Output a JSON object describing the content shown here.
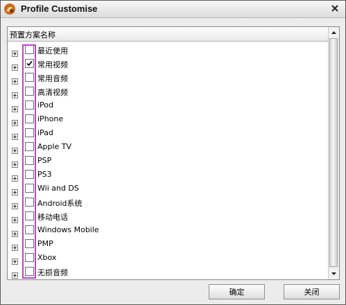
{
  "window": {
    "title": "Profile Customise"
  },
  "table": {
    "header": "预置方案名称"
  },
  "items": [
    {
      "label": "最近使用",
      "checked": false
    },
    {
      "label": "常用视频",
      "checked": true
    },
    {
      "label": "常用音频",
      "checked": false
    },
    {
      "label": "高清视频",
      "checked": false
    },
    {
      "label": "iPod",
      "checked": false
    },
    {
      "label": "iPhone",
      "checked": false
    },
    {
      "label": "iPad",
      "checked": false
    },
    {
      "label": "Apple TV",
      "checked": false
    },
    {
      "label": "PSP",
      "checked": false
    },
    {
      "label": "PS3",
      "checked": false
    },
    {
      "label": "Wii and DS",
      "checked": false
    },
    {
      "label": "Android系统",
      "checked": false
    },
    {
      "label": "移动电话",
      "checked": false
    },
    {
      "label": "Windows Mobile",
      "checked": false
    },
    {
      "label": "PMP",
      "checked": false
    },
    {
      "label": "Xbox",
      "checked": false
    },
    {
      "label": "无损音频",
      "checked": false
    }
  ],
  "buttons": {
    "confirm": "确定",
    "close": "关闭"
  },
  "colors": {
    "highlight": "#c040c8"
  }
}
